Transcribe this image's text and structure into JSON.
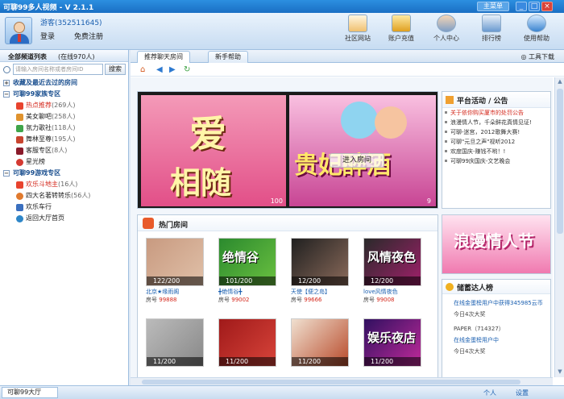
{
  "window": {
    "title": "可聊99多人视频 - V 2.1.1",
    "main_menu": "主菜单",
    "min": "_",
    "max": "□",
    "close": "×"
  },
  "user": {
    "name": "游客(352511645)",
    "login": "登录",
    "register": "免费注册"
  },
  "header_buttons": [
    {
      "label": "社区网站",
      "icon": "home-icon"
    },
    {
      "label": "账户充值",
      "icon": "yen-icon"
    },
    {
      "label": "个人中心",
      "icon": "user-icon"
    },
    {
      "label": "排行榜",
      "icon": "chart-icon"
    },
    {
      "label": "使用帮助",
      "icon": "help-icon"
    }
  ],
  "sidebar": {
    "tab_all": "全部频道列表",
    "online": "在线970人",
    "search_placeholder": "请输入房间名称或者房间ID",
    "search_button": "搜索",
    "sections": [
      {
        "label": "收藏及最近去过的房间",
        "items": []
      },
      {
        "label": "可聊99家族专区",
        "items": [
          {
            "label": "热点推荐",
            "count": "(269人)",
            "color": "#e8432e"
          },
          {
            "label": "美女聊吧",
            "count": "(258人)",
            "color": "#e0932e"
          },
          {
            "label": "氛力歌社",
            "count": "(118人)",
            "color": "#3fa54a"
          },
          {
            "label": "舞林至尊",
            "count": "(195人)",
            "color": "#c8442e"
          },
          {
            "label": "客服专区",
            "count": "(8人)",
            "color": "#8a1a2a"
          },
          {
            "label": "星光榜",
            "count": "",
            "color": "#d43a32"
          }
        ]
      },
      {
        "label": "可聊99游戏专区",
        "items": [
          {
            "label": "欢乐斗地主",
            "count": "(16人)",
            "color": "#e8432e"
          },
          {
            "label": "四大名著转转乐",
            "count": "(56人)",
            "color": "#e07a2e"
          },
          {
            "label": "欢乐车行",
            "count": "",
            "color": "#3a6fbf"
          },
          {
            "label": "返回大厅首页",
            "count": "",
            "color": "#2e86c8"
          }
        ]
      }
    ]
  },
  "tabs": [
    {
      "label": "推荐聊天房间",
      "active": true
    },
    {
      "label": "新手帮助",
      "active": false
    }
  ],
  "tools_label": "工具下载",
  "banner": {
    "left_text_1": "爱",
    "left_text_2": "相随",
    "left_count": "100",
    "right_text": "贵妃醉酒",
    "enter_button": "进入房间",
    "right_count": "9"
  },
  "hot_rooms": {
    "title": "热门房间",
    "rooms": [
      {
        "count": "122/200",
        "name": "北京★缘雨阁",
        "room_no_label": "房号",
        "room_no": "99888",
        "color1": "#c89a80",
        "color2": "#e0c0a8"
      },
      {
        "count": "101/200",
        "name": "╋绝情谷╋",
        "room_no_label": "房号",
        "room_no": "99002",
        "color1": "#2b8a2e",
        "color2": "#6ac040",
        "overlay": "绝情谷"
      },
      {
        "count": "12/200",
        "name": "天使【便之岛】",
        "room_no_label": "房号",
        "room_no": "99666",
        "color1": "#202020",
        "color2": "#8a6a5a"
      },
      {
        "count": "12/200",
        "name": "love风情夜色",
        "room_no_label": "房号",
        "room_no": "99008",
        "color1": "#2a2a2a",
        "color2": "#a0206a",
        "overlay": "风情夜色"
      },
      {
        "count": "11/200",
        "name": "",
        "room_no_label": "",
        "room_no": "",
        "color1": "#bbbbbb",
        "color2": "#888888"
      },
      {
        "count": "11/200",
        "name": "",
        "room_no_label": "",
        "room_no": "",
        "color1": "#a01a1a",
        "color2": "#d8443a"
      },
      {
        "count": "11/200",
        "name": "",
        "room_no_label": "",
        "room_no": "",
        "color1": "#f0e0d0",
        "color2": "#b84a2a"
      },
      {
        "count": "11/200",
        "name": "",
        "room_no_label": "",
        "room_no": "",
        "color1": "#301060",
        "color2": "#c02a9a",
        "overlay": "娱乐夜店"
      }
    ]
  },
  "notice": {
    "title": "平台活动 / 公告",
    "items": [
      {
        "text": "关于依你购买厦市的处罚公告",
        "red": true
      },
      {
        "text": "浪漫情人节，千朵鲜花真情见证!",
        "red": false
      },
      {
        "text": "可聊-迷宫，2012歌舞大赛!",
        "red": false
      },
      {
        "text": "可聊\"元旦之声\"视听2012",
        "red": false
      },
      {
        "text": "欢度国庆-赚钱不哟！!",
        "red": false
      },
      {
        "text": "可聊99庆国庆-文艺晚会",
        "red": false
      }
    ]
  },
  "ad_text": "浪漫情人节",
  "rank": {
    "title": "储蓄达人榜",
    "line1": "在线金蛋榜用户中获得345985云币",
    "line2": "今日4次大奖",
    "line3": "PAPER（714327）",
    "line4": "在线金蛋榜用户中",
    "line5": "今日4次大奖"
  },
  "status": {
    "lobby": "可聊99大厅",
    "personal": "个人",
    "settings": "设置"
  }
}
